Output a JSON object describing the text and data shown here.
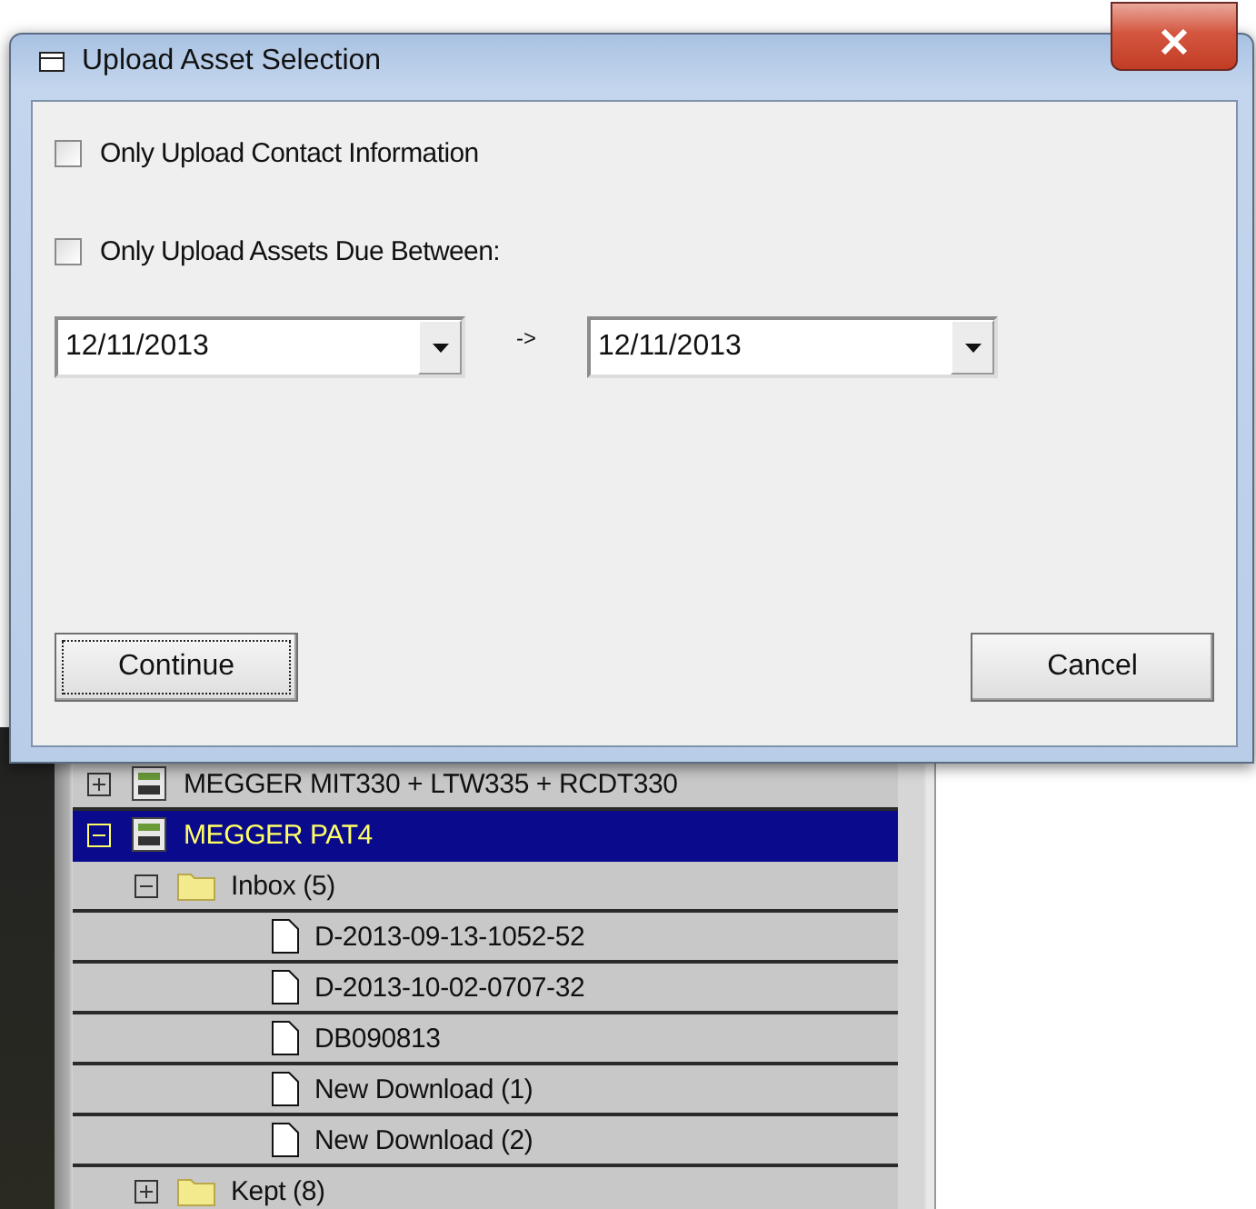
{
  "dialog": {
    "title": "Upload Asset Selection",
    "options": [
      {
        "label": "Only Upload Contact Information",
        "checked": false
      },
      {
        "label": "Only Upload Assets Due Between:",
        "checked": false
      }
    ],
    "date_from": "12/11/2013",
    "range_arrow": "->",
    "date_to": "12/11/2013",
    "buttons": [
      {
        "label": "Continue",
        "focused": true
      },
      {
        "label": "Cancel",
        "focused": false
      }
    ]
  },
  "tree": [
    {
      "kind": "device",
      "label": "MEGGER MIT330 + LTW335 + RCDT330",
      "expanded": false,
      "selected": false
    },
    {
      "kind": "device",
      "label": "MEGGER PAT4",
      "expanded": true,
      "selected": true,
      "children": [
        {
          "kind": "folder",
          "label": "Inbox (5)",
          "expanded": true,
          "selected": false,
          "children": [
            {
              "kind": "file",
              "label": "D-2013-09-13-1052-52",
              "selected": false
            },
            {
              "kind": "file",
              "label": "D-2013-10-02-0707-32",
              "selected": false
            },
            {
              "kind": "file",
              "label": "DB090813",
              "selected": false
            },
            {
              "kind": "file",
              "label": "New Download (1)",
              "selected": false
            },
            {
              "kind": "file",
              "label": "New Download (2)",
              "selected": false
            }
          ]
        },
        {
          "kind": "folder",
          "label": "Kept (8)",
          "expanded": false,
          "selected": false
        }
      ]
    }
  ]
}
